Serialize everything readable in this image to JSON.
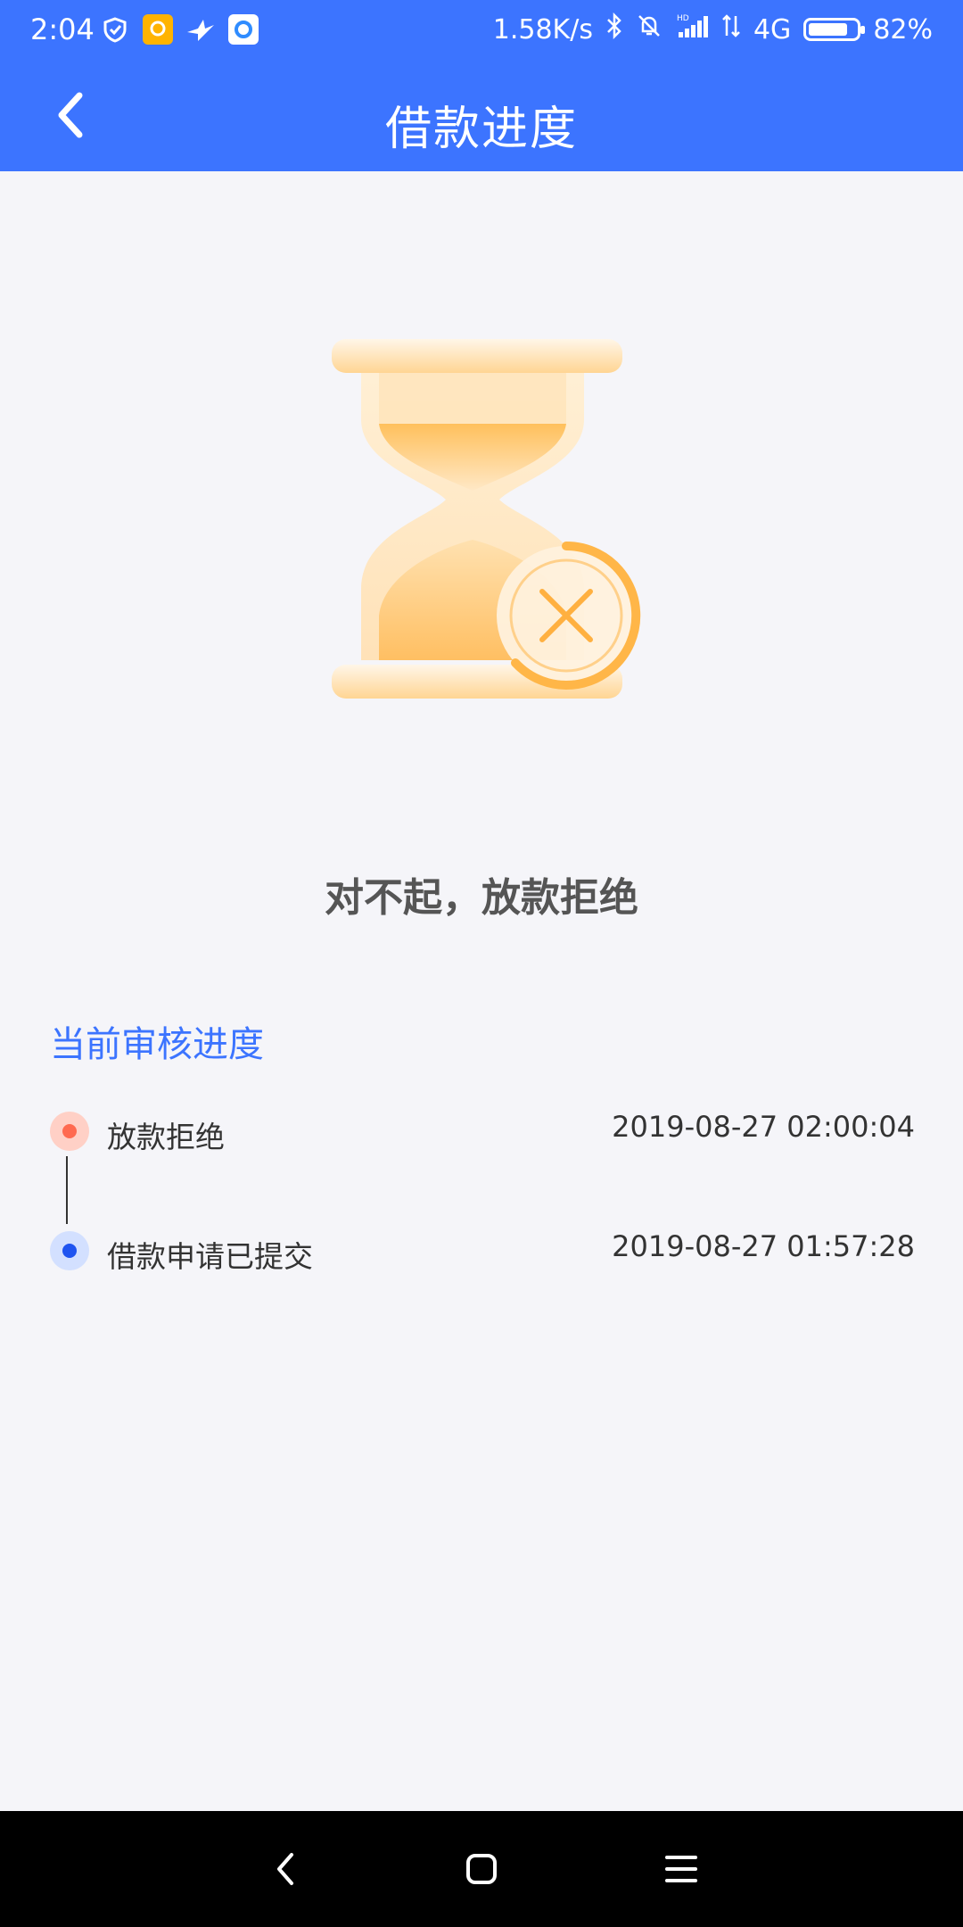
{
  "status_bar": {
    "time": "2:04",
    "network_speed": "1.58K/s",
    "network_type": "4G",
    "battery": "82%",
    "battery_level": 0.82,
    "icons": [
      "shield-icon",
      "chat-icon",
      "bird-icon",
      "browser-icon",
      "bluetooth-icon",
      "mute-bell-icon",
      "hd-signal-icon",
      "data-arrows-icon",
      "battery-icon"
    ]
  },
  "header": {
    "title": "借款进度",
    "back_icon": "chevron-left-icon"
  },
  "result": {
    "icon": "hourglass-rejected-icon",
    "message": "对不起，放款拒绝"
  },
  "progress": {
    "section_title": "当前审核进度",
    "steps": [
      {
        "label": "放款拒绝",
        "time": "2019-08-27 02:00:04",
        "status": "rejected",
        "color": "#ff6a50"
      },
      {
        "label": "借款申请已提交",
        "time": "2019-08-27 01:57:28",
        "status": "submitted",
        "color": "#1f54f0"
      }
    ]
  },
  "nav_bar": {
    "buttons": [
      "back-nav-icon",
      "home-nav-icon",
      "menu-nav-icon"
    ]
  },
  "colors": {
    "brand_blue": "#3c74ff",
    "background": "#f5f5f9",
    "hourglass_orange": "#ffb84d"
  }
}
